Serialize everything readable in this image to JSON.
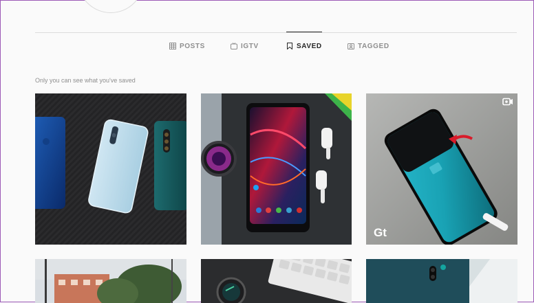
{
  "profile": {
    "avatar": "profile-photo"
  },
  "tabs": [
    {
      "label": "POSTS",
      "icon": "grid-icon",
      "active": false
    },
    {
      "label": "IGTV",
      "icon": "igtv-icon",
      "active": false
    },
    {
      "label": "SAVED",
      "icon": "bookmark-icon",
      "active": true
    },
    {
      "label": "TAGGED",
      "icon": "tagged-icon",
      "active": false
    }
  ],
  "saved_notice": "Only you can see what you've saved",
  "grid": [
    {
      "description": "Three smartphones (blue, white, teal) on carbon fibre surface"
    },
    {
      "description": "Smartphone with colourful wallpaper, smartwatch and wireless earbuds"
    },
    {
      "description": "Teal power bank with red arrow and Gt watermark",
      "badge": "video-icon",
      "watermark": "Gt"
    },
    {
      "description": "Building with trees and sky"
    },
    {
      "description": "Keyboard with smartwatch on dark desk"
    },
    {
      "description": "Teal smartphone with camera on white surface"
    }
  ],
  "colors": {
    "background": "#fafafa",
    "divider": "#dbdbdb",
    "text_muted": "#8e8e8e",
    "text_active": "#262626"
  }
}
